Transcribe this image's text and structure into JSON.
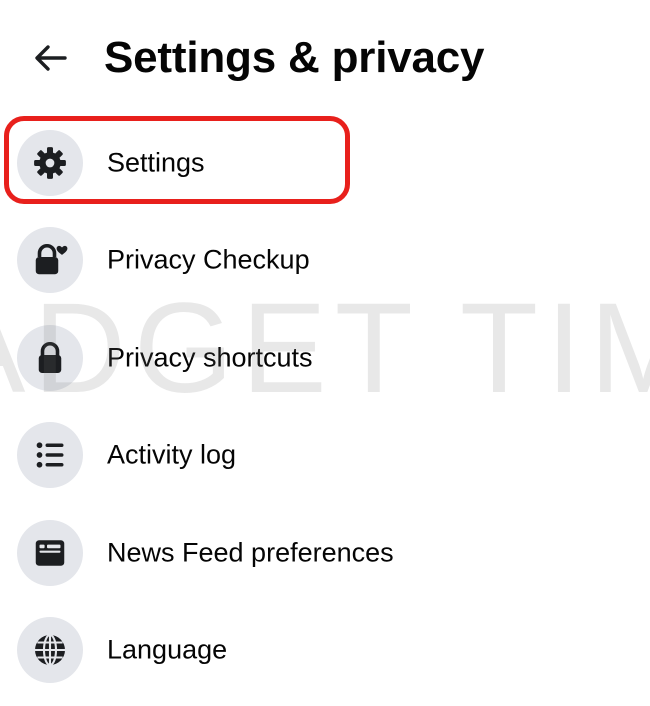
{
  "header": {
    "back_icon": "arrow-left-icon",
    "title": "Settings & privacy"
  },
  "menu": {
    "items": [
      {
        "label": "Settings",
        "icon": "gear-icon",
        "highlighted": true
      },
      {
        "label": "Privacy Checkup",
        "icon": "lock-heart-icon"
      },
      {
        "label": "Privacy shortcuts",
        "icon": "lock-icon"
      },
      {
        "label": "Activity log",
        "icon": "list-icon"
      },
      {
        "label": "News Feed preferences",
        "icon": "feed-icon"
      },
      {
        "label": "Language",
        "icon": "globe-icon"
      }
    ]
  },
  "watermark": {
    "text": "ADGET TIM"
  },
  "colors": {
    "icon_background": "#e4e6eb",
    "highlight_border": "#e8201c",
    "text": "#050505"
  }
}
